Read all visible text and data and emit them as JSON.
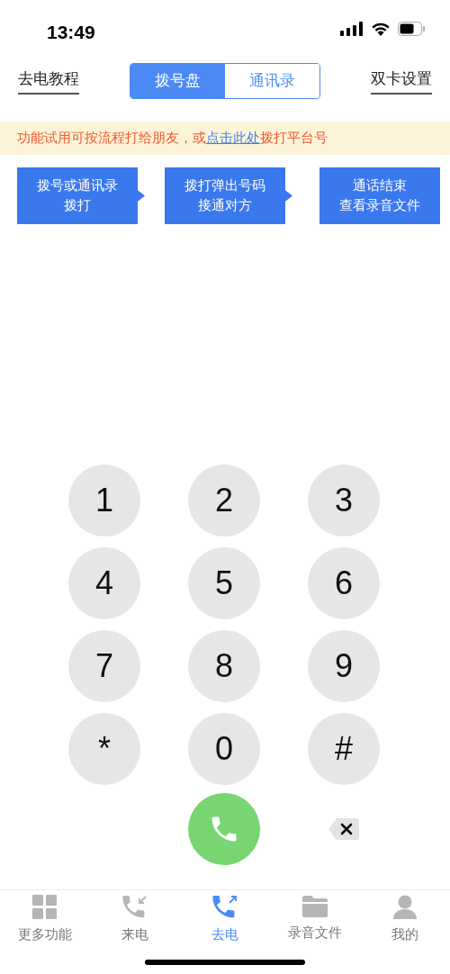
{
  "status_bar": {
    "time": "13:49"
  },
  "header": {
    "left_link": "去电教程",
    "segments": [
      {
        "label": "拨号盘",
        "selected": true
      },
      {
        "label": "通讯录",
        "selected": false
      }
    ],
    "right_link": "双卡设置"
  },
  "banner": {
    "before": "功能试用可按流程打给朋友，或",
    "link": "点击此处",
    "after": "拨打平台号"
  },
  "steps": [
    {
      "lines": [
        "拨号或通讯录",
        "拨打"
      ],
      "arrow": true
    },
    {
      "lines": [
        "拨打弹出号码",
        "接通对方"
      ],
      "arrow": true
    },
    {
      "lines": [
        "通话结束",
        "查看录音文件"
      ],
      "arrow": false
    }
  ],
  "keypad": [
    "1",
    "2",
    "3",
    "4",
    "5",
    "6",
    "7",
    "8",
    "9",
    "*",
    "0",
    "#"
  ],
  "tab_bar": [
    {
      "label": "更多功能",
      "selected": false
    },
    {
      "label": "来电",
      "selected": false
    },
    {
      "label": "去电",
      "selected": true
    },
    {
      "label": "录音文件",
      "selected": false
    },
    {
      "label": "我的",
      "selected": false
    }
  ]
}
